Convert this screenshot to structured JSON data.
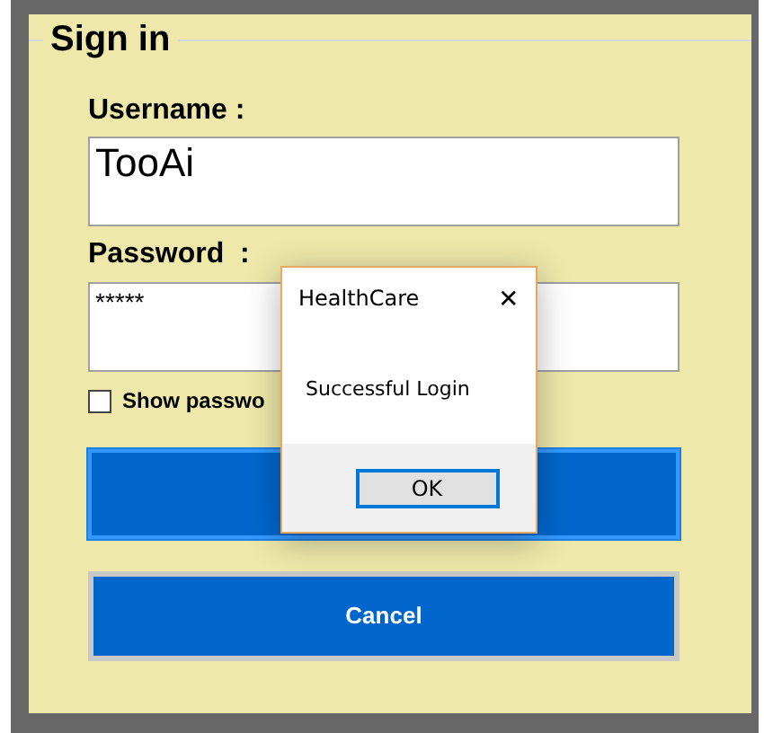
{
  "group": {
    "title": "Sign in"
  },
  "username": {
    "label": "Username :",
    "value": "TooAi"
  },
  "password": {
    "label": "Password  :",
    "value": "*****"
  },
  "show_password": {
    "label": "Show passwo",
    "checked": false
  },
  "cancel_button": {
    "label": "Cancel"
  },
  "dialog": {
    "title": "HealthCare",
    "close": "✕",
    "message": "Successful Login",
    "button": "OK"
  }
}
